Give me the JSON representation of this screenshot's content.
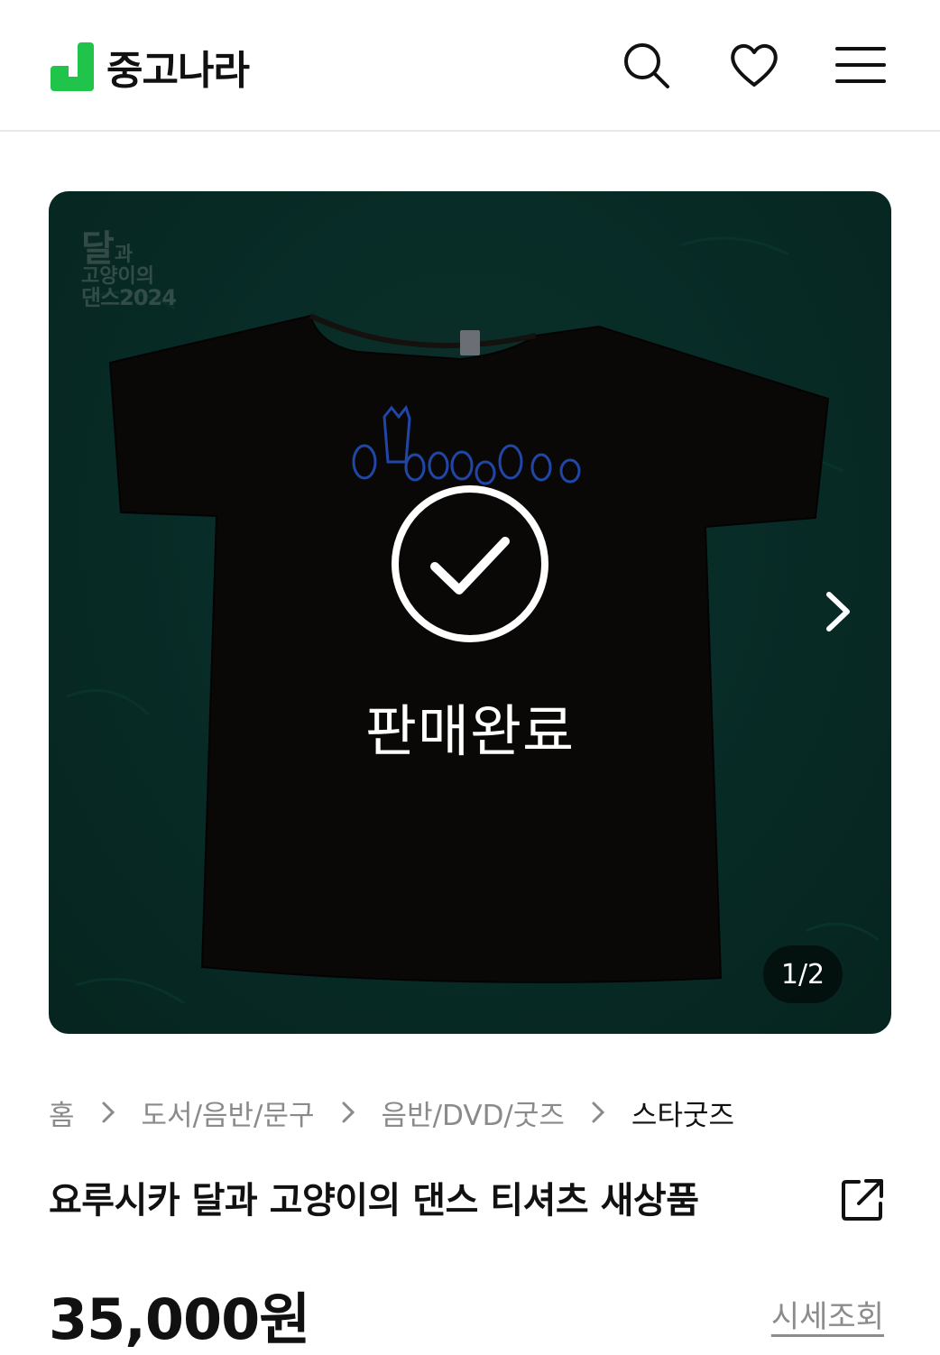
{
  "header": {
    "logo_text": "중고나라",
    "brand_color": "#20c44b",
    "icons": [
      "search-icon",
      "heart-icon",
      "menu-icon"
    ]
  },
  "gallery": {
    "watermark": {
      "line1": "달",
      "line1_small": "과",
      "line2": "고양이의",
      "line3": "댄스2024"
    },
    "sold_status": "판매완료",
    "counter": "1/2",
    "background_color": "#0b3a33"
  },
  "breadcrumb": [
    "홈",
    "도서/음반/문구",
    "음반/DVD/굿즈",
    "스타굿즈"
  ],
  "product": {
    "title": "요루시카 달과 고양이의 댄스 티셔츠 새상품",
    "price": "35,000원",
    "market_price_link": "시세조회"
  }
}
